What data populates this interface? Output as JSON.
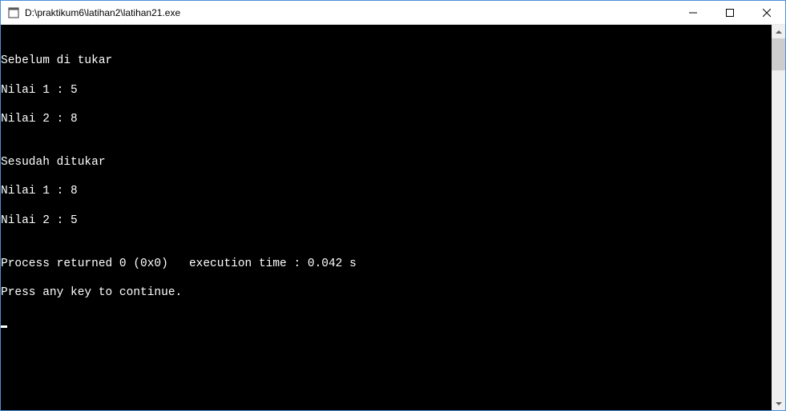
{
  "window": {
    "title": "D:\\praktikum6\\latihan2\\latihan21.exe"
  },
  "console": {
    "lines": [
      "",
      "Sebelum di tukar",
      "Nilai 1 : 5",
      "Nilai 2 : 8",
      "",
      "Sesudah ditukar",
      "Nilai 1 : 8",
      "Nilai 2 : 5",
      "",
      "Process returned 0 (0x0)   execution time : 0.042 s",
      "Press any key to continue."
    ]
  }
}
